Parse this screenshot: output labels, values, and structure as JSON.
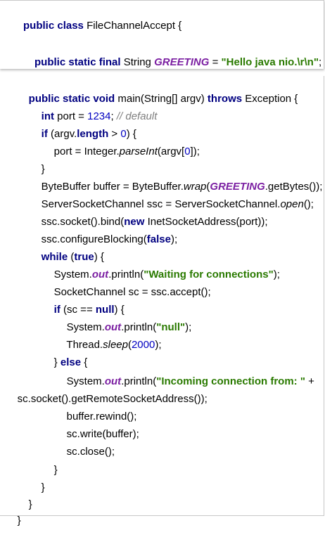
{
  "code": {
    "l1": {
      "kw1": "public",
      "kw2": "class",
      "name": "FileChannelAccept",
      "brace": " {"
    },
    "l2": {
      "kw": "public static final",
      "type": "String",
      "field": "GREETING",
      "eq": "=",
      "str": "\"Hello java nio.\\r\\n\"",
      "end": ";"
    },
    "l3": {
      "kw": "public static void",
      "rest1": "main(String[] argv)",
      "throws": "throws",
      "rest2": "Exception {"
    },
    "l4": {
      "kw": "int",
      "rest": "port =",
      "num": "1234",
      "semi": ";",
      "cmt": "// default"
    },
    "l5": {
      "kw": "if",
      "rest1": "(argv.",
      "kw2": "length",
      "rest2": ">",
      "num": "0",
      "rest3": ") {"
    },
    "l6": {
      "rest1": "port = Integer.",
      "method": "parseInt",
      "rest2": "(argv[",
      "num": "0",
      "rest3": "]);"
    },
    "l7": {
      "text": "}"
    },
    "l8": {
      "rest1": "ByteBuffer buffer = ByteBuffer.",
      "method": "wrap",
      "paren": "(",
      "field": "GREETING",
      "rest2": ".getBytes());"
    },
    "l9": {
      "rest1": "ServerSocketChannel ssc = ServerSocketChannel.",
      "method": "open",
      "rest2": "();"
    },
    "l10": {
      "rest1": "ssc.socket().bind(",
      "kw": "new",
      "rest2": "InetSocketAddress(port));"
    },
    "l11": {
      "rest1": "ssc.configureBlocking(",
      "kw": "false",
      "rest2": ");"
    },
    "l12": {
      "kw": "while",
      "rest1": "(",
      "kw2": "true",
      "rest2": ") {"
    },
    "l13": {
      "rest1": "System.",
      "field": "out",
      "rest2": ".println(",
      "str": "\"Waiting for connections\"",
      "rest3": ");"
    },
    "l14": {
      "text": "SocketChannel sc = ssc.accept();"
    },
    "l15": {
      "kw": "if",
      "rest1": "(sc ==",
      "kw2": "null",
      "rest2": ") {"
    },
    "l16": {
      "rest1": "System.",
      "field": "out",
      "rest2": ".println(",
      "str": "\"null\"",
      "rest3": ");"
    },
    "l17": {
      "rest1": "Thread.",
      "method": "sleep",
      "rest2": "(",
      "num": "2000",
      "rest3": ");"
    },
    "l18": {
      "rest1": "}",
      "kw": "else",
      "rest2": "{"
    },
    "l19": {
      "rest1": "System.",
      "field": "out",
      "rest2": ".println(",
      "str": "\"Incoming connection from: \"",
      "rest3": "+"
    },
    "l20": {
      "text": "sc.socket().getRemoteSocketAddress());"
    },
    "l21": {
      "text": "buffer.rewind();"
    },
    "l22": {
      "text": "sc.write(buffer);"
    },
    "l23": {
      "text": "sc.close();"
    },
    "l24": {
      "text": "}"
    },
    "l25": {
      "text": "}"
    },
    "l26": {
      "text": "}"
    },
    "l27": {
      "text": "}"
    }
  }
}
